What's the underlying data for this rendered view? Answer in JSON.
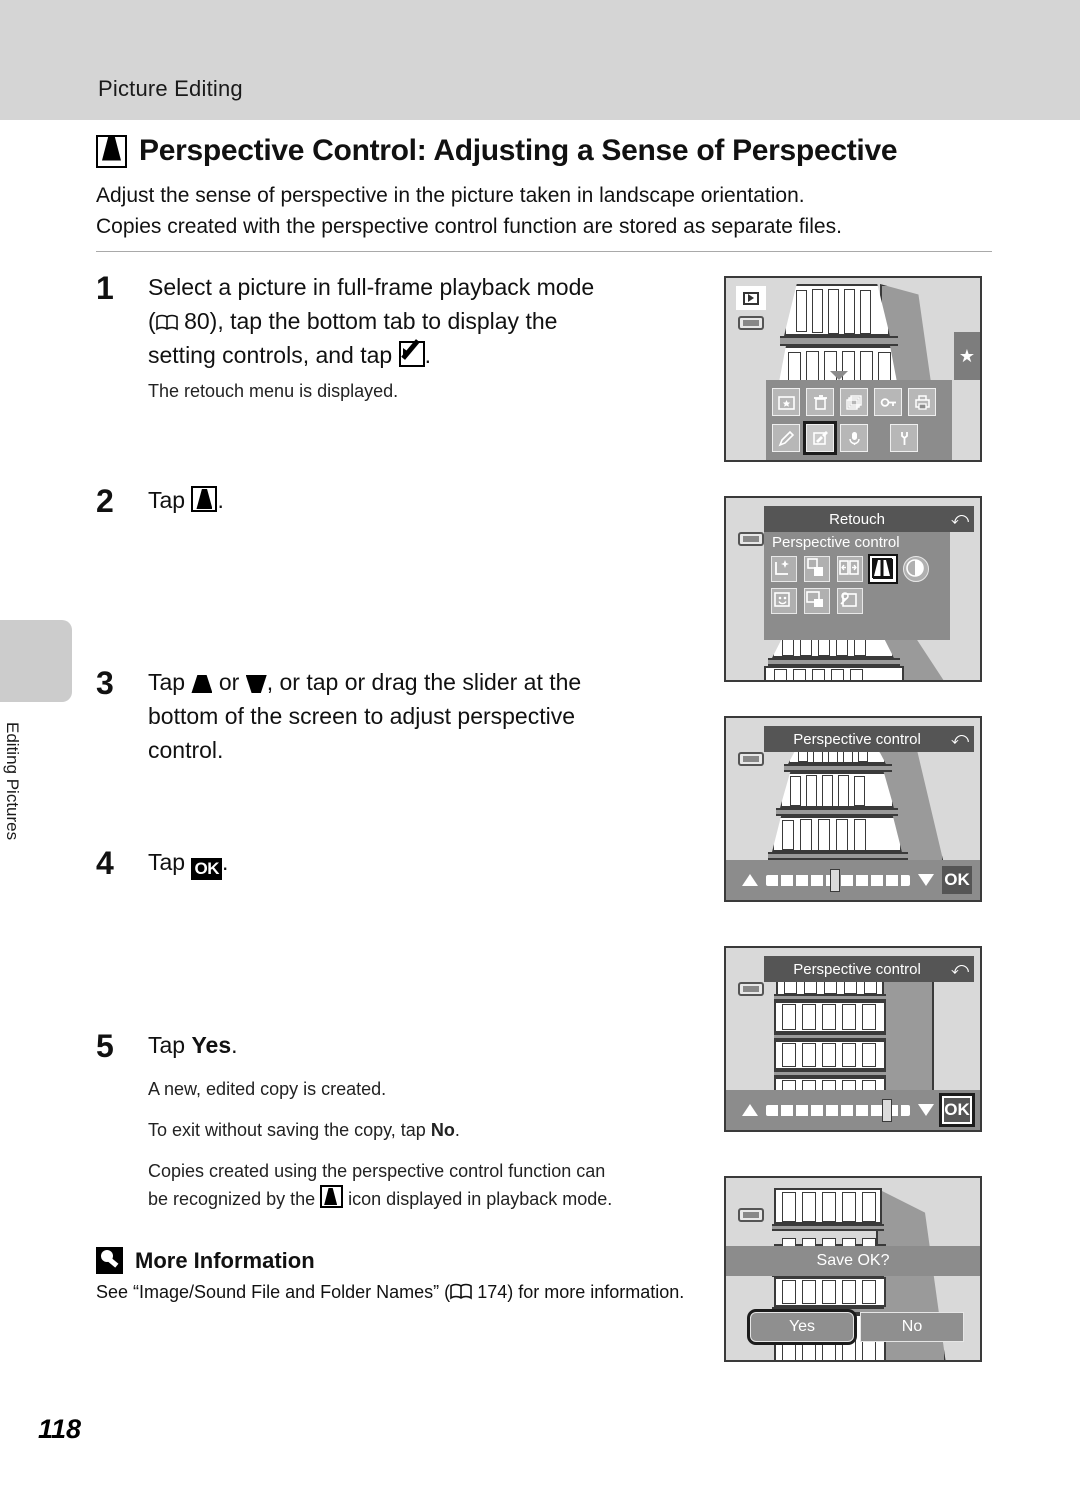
{
  "header": {
    "running_head": "Picture Editing"
  },
  "sidebar": {
    "chapter_label": "Editing Pictures"
  },
  "page": {
    "number": "118"
  },
  "section": {
    "icon": "perspective-control-icon",
    "title": "Perspective Control: Adjusting a Sense of Perspective",
    "intro_line1": "Adjust the sense of perspective in the picture taken in landscape orientation.",
    "intro_line2": "Copies created with the perspective control function are stored as separate files."
  },
  "steps": [
    {
      "number": "1",
      "head_part1": "Select a picture in full-frame playback mode",
      "head_part2": "(",
      "head_ref": "80",
      "head_part3": "), tap the bottom tab to display the",
      "head_part4": "setting controls, and tap",
      "head_part5": ".",
      "sub": "The retouch menu is displayed.",
      "screen": {
        "name": "full-frame-playback-with-setting-controls",
        "badges": [
          "playback-icon",
          "battery-icon"
        ],
        "right_tab": "★",
        "tray_keys_row1": [
          "favorites-icon",
          "delete-icon",
          "slideshow-icon",
          "protect-icon",
          "print-icon"
        ],
        "tray_keys_row2": [
          "draw-icon",
          "retouch-icon",
          "voice-memo-icon",
          "settings-icon"
        ],
        "selected_key": "retouch-icon"
      }
    },
    {
      "number": "2",
      "head_prefix": "Tap",
      "head_suffix": ".",
      "screen": {
        "name": "retouch-menu",
        "title": "Retouch",
        "subtitle": "Perspective control",
        "back_button": "⤺",
        "menu_row1": [
          "quick-retouch-icon",
          "d-lighting-icon",
          "skin-softening-icon",
          "perspective-control-icon",
          "filter-effects-icon"
        ],
        "menu_row2": [
          "makeup-icon",
          "small-picture-icon",
          "crop-icon"
        ],
        "selected_item": "perspective-control-icon"
      }
    },
    {
      "number": "3",
      "head_part1": "Tap",
      "head_part2": "or",
      "head_part3": ", or tap or drag the slider at the",
      "head_part4": "bottom of the screen to adjust perspective",
      "head_part5": "control.",
      "screen": {
        "name": "perspective-control-adjust",
        "title": "Perspective control",
        "back_button": "⤺",
        "slider_position_percent": 48,
        "ok_label": "OK",
        "up_icon": "trapezoid-up-icon",
        "down_icon": "trapezoid-down-icon"
      }
    },
    {
      "number": "4",
      "head_prefix": "Tap",
      "head_suffix": ".",
      "ok_label": "OK",
      "screen": {
        "name": "perspective-control-corrected",
        "title": "Perspective control",
        "back_button": "⤺",
        "slider_position_percent": 84,
        "ok_label": "OK",
        "ok_selected": true
      }
    },
    {
      "number": "5",
      "head_prefix": "Tap",
      "head_bold": "Yes",
      "head_suffix": ".",
      "sub1": "A new, edited copy is created.",
      "sub2_part1": "To exit without saving the copy, tap",
      "sub2_bold": "No",
      "sub2_part2": ".",
      "sub3_part1": "Copies created using the perspective control function can",
      "sub3_part2": "be recognized by the",
      "sub3_part3": "icon displayed in playback mode.",
      "screen": {
        "name": "save-confirmation-dialog",
        "prompt": "Save OK?",
        "yes_label": "Yes",
        "no_label": "No",
        "selected_button": "Yes"
      }
    }
  ],
  "more_information": {
    "icon": "tip-bulb-icon",
    "title": "More Information",
    "body_part1": "See “Image/Sound File and Folder Names” (",
    "body_ref": "174",
    "body_part2": ") for more information."
  },
  "colors": {
    "header_band": "#d5d5d5",
    "side_tab": "#cccccc",
    "screen_bg": "#d9d9d9",
    "menu_gray": "#8c8c8c",
    "titlebar_gray": "#555555",
    "outline": "#3a3a3a"
  }
}
